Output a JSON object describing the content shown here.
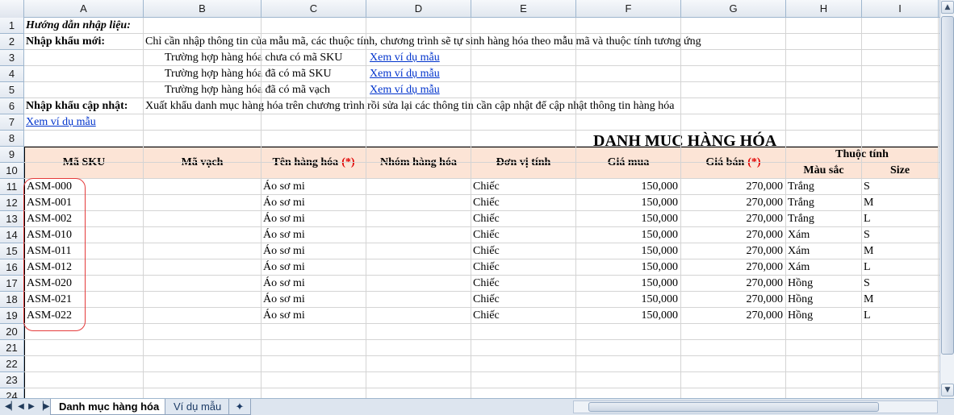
{
  "columns": [
    "A",
    "B",
    "C",
    "D",
    "E",
    "F",
    "G",
    "H",
    "I"
  ],
  "rows": [
    "1",
    "2",
    "3",
    "4",
    "5",
    "6",
    "7",
    "8",
    "9",
    "10",
    "11",
    "12",
    "13",
    "14",
    "15",
    "16",
    "17",
    "18",
    "19",
    "20",
    "21",
    "22",
    "23",
    "24"
  ],
  "guide": {
    "heading": "Hướng dẫn nhập liệu:",
    "new_import_label": "Nhập khẩu mới:",
    "new_import_text": "Chỉ cần nhập thông tin của mẫu mã, các thuộc tính, chương trình sẽ tự sinh hàng hóa theo mẫu mã và thuộc tính tương ứng",
    "case1": "Trường hợp hàng hóa chưa có mã SKU",
    "case2": "Trường hợp hàng hóa đã có mã SKU",
    "case3": "Trường hợp hàng hóa đã có mã vạch",
    "sample_link": "Xem ví dụ mẫu",
    "update_label": "Nhập khẩu cập nhật:",
    "update_text": "Xuất khẩu danh mục hàng hóa trên chương trình rồi sửa lại các thông tin cần cập nhật để cập nhật thông tin hàng hóa"
  },
  "title": "DANH MỤC HÀNG HÓA",
  "headers": {
    "sku": "Mã SKU",
    "barcode": "Mã vạch",
    "name": "Tên hàng hóa",
    "group": "Nhóm hàng hóa",
    "unit": "Đơn vị tính",
    "buy": "Giá mua",
    "sell": "Giá bán",
    "required_mark": "(*)",
    "attributes": "Thuộc tính",
    "color": "Màu sắc",
    "size": "Size"
  },
  "table_rows": [
    {
      "sku": "ASM-000",
      "name": "Áo sơ mi",
      "unit": "Chiếc",
      "buy": "150,000",
      "sell": "270,000",
      "color": "Trắng",
      "size": "S"
    },
    {
      "sku": "ASM-001",
      "name": "Áo sơ mi",
      "unit": "Chiếc",
      "buy": "150,000",
      "sell": "270,000",
      "color": "Trắng",
      "size": "M"
    },
    {
      "sku": "ASM-002",
      "name": "Áo sơ mi",
      "unit": "Chiếc",
      "buy": "150,000",
      "sell": "270,000",
      "color": "Trắng",
      "size": "L"
    },
    {
      "sku": "ASM-010",
      "name": "Áo sơ mi",
      "unit": "Chiếc",
      "buy": "150,000",
      "sell": "270,000",
      "color": "Xám",
      "size": "S"
    },
    {
      "sku": "ASM-011",
      "name": "Áo sơ mi",
      "unit": "Chiếc",
      "buy": "150,000",
      "sell": "270,000",
      "color": "Xám",
      "size": "M"
    },
    {
      "sku": "ASM-012",
      "name": "Áo sơ mi",
      "unit": "Chiếc",
      "buy": "150,000",
      "sell": "270,000",
      "color": "Xám",
      "size": "L"
    },
    {
      "sku": "ASM-020",
      "name": "Áo sơ mi",
      "unit": "Chiếc",
      "buy": "150,000",
      "sell": "270,000",
      "color": "Hồng",
      "size": "S"
    },
    {
      "sku": "ASM-021",
      "name": "Áo sơ mi",
      "unit": "Chiếc",
      "buy": "150,000",
      "sell": "270,000",
      "color": "Hồng",
      "size": "M"
    },
    {
      "sku": "ASM-022",
      "name": "Áo sơ mi",
      "unit": "Chiếc",
      "buy": "150,000",
      "sell": "270,000",
      "color": "Hồng",
      "size": "L"
    }
  ],
  "sheet_tabs": [
    {
      "label": "Danh mục hàng hóa",
      "active": true
    },
    {
      "label": "Ví dụ mẫu",
      "active": false
    }
  ],
  "icons": {
    "nav_first": "first-sheet-icon",
    "nav_prev": "prev-sheet-icon",
    "nav_next": "next-sheet-icon",
    "nav_last": "last-sheet-icon",
    "insert_sheet": "insert-sheet-icon",
    "scroll_up": "scroll-up-icon",
    "scroll_down": "scroll-down-icon"
  },
  "colors": {
    "header_fill": "#fce4d6",
    "required": "#e00000",
    "link": "#0033cc",
    "callout": "#e53b3b"
  }
}
